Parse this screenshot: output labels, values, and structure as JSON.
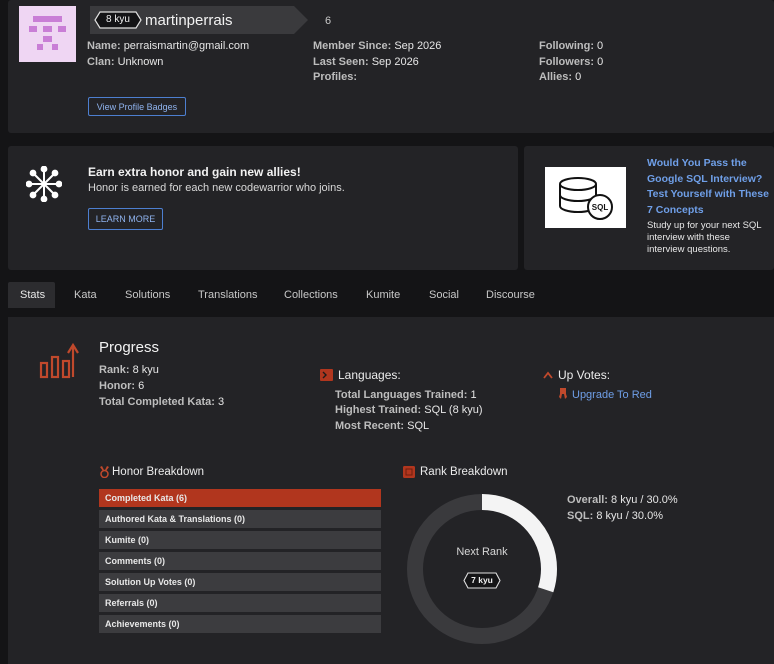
{
  "profile": {
    "rank_badge": "8 kyu",
    "username": "martinperrais",
    "honor_count": "6",
    "name_label": "Name:",
    "name_value": "perraismartin@gmail.com",
    "clan_label": "Clan:",
    "clan_value": "Unknown",
    "member_since_label": "Member Since:",
    "member_since_value": "Sep 2026",
    "last_seen_label": "Last Seen:",
    "last_seen_value": "Sep 2026",
    "profiles_label": "Profiles:",
    "following_label": "Following:",
    "following_value": "0",
    "followers_label": "Followers:",
    "followers_value": "0",
    "allies_label": "Allies:",
    "allies_value": "0",
    "badges_button": "View Profile Badges"
  },
  "promo": {
    "title": "Earn extra honor and gain new allies!",
    "text": "Honor is earned for each new codewarrior who joins.",
    "button": "LEARN MORE"
  },
  "ad": {
    "image_text": "SQL",
    "title_line1": "Would You Pass the",
    "title_line2": "Google SQL Interview?",
    "title_line3": "Test Yourself with These",
    "title_line4": "7 Concepts",
    "body_line1": "Study up for your next SQL",
    "body_line2": "interview with these",
    "body_line3": "interview questions."
  },
  "tabs": [
    "Stats",
    "Kata",
    "Solutions",
    "Translations",
    "Collections",
    "Kumite",
    "Social",
    "Discourse"
  ],
  "progress": {
    "title": "Progress",
    "rank_label": "Rank:",
    "rank_value": "8 kyu",
    "honor_label": "Honor:",
    "honor_value": "6",
    "completed_label": "Total Completed Kata:",
    "completed_value": "3"
  },
  "languages": {
    "title": "Languages:",
    "trained_label": "Total Languages Trained:",
    "trained_value": "1",
    "highest_label": "Highest Trained:",
    "highest_value": "SQL (8 kyu)",
    "recent_label": "Most Recent:",
    "recent_value": "SQL"
  },
  "upvotes": {
    "title": "Up Votes:",
    "link": "Upgrade To Red"
  },
  "honor_breakdown": {
    "title": "Honor Breakdown",
    "items": [
      "Completed Kata (6)",
      "Authored Kata & Translations (0)",
      "Kumite (0)",
      "Comments (0)",
      "Solution Up Votes (0)",
      "Referrals (0)",
      "Achievements (0)"
    ]
  },
  "rank_breakdown": {
    "title": "Rank Breakdown",
    "next_rank_label": "Next Rank",
    "next_rank_badge": "7 kyu",
    "progress_fraction": 0.3,
    "overall_label": "Overall:",
    "overall_value": "8 kyu / 30.0%",
    "sql_label": "SQL:",
    "sql_value": "8 kyu / 30.0%"
  },
  "colors": {
    "accent_red": "#b1361e",
    "link_blue": "#6f9fe8",
    "panel": "#232326"
  }
}
